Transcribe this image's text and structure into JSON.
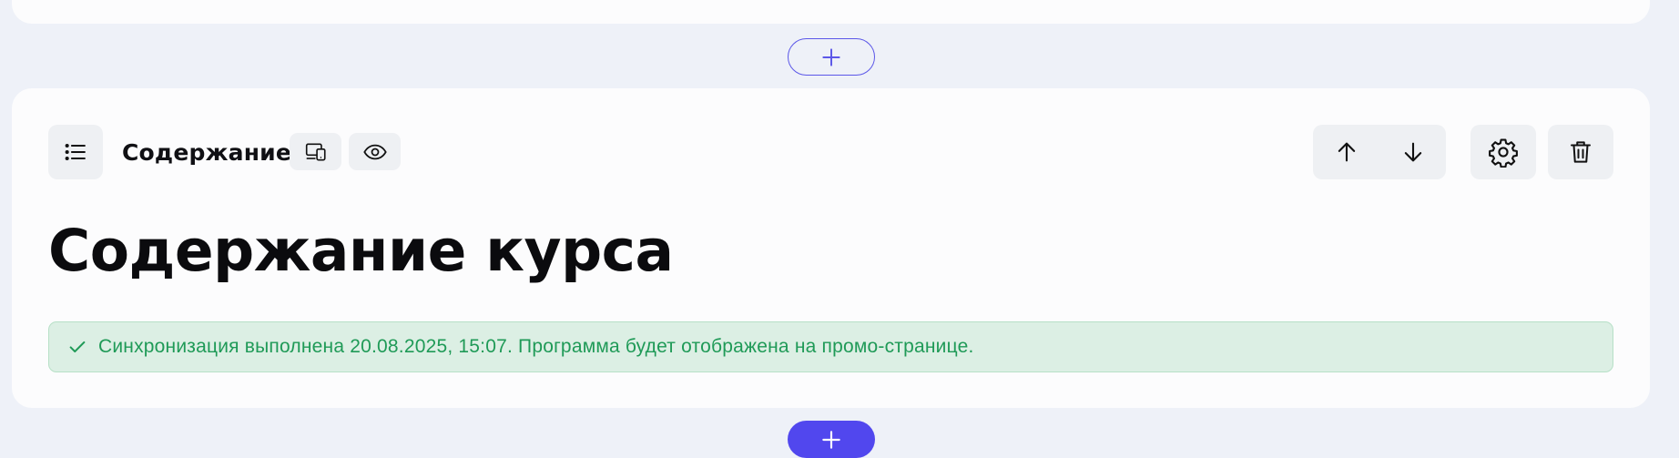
{
  "block": {
    "label": "Содержание",
    "heading": "Содержание курса"
  },
  "sync_banner": {
    "text": "Синхронизация выполнена 20.08.2025, 15:07. Программа будет отображена на промо-странице."
  },
  "colors": {
    "accent": "#5147ee",
    "success_text": "#1f9a57",
    "success_bg": "#dcefe4",
    "page_bg": "#eef1f8"
  },
  "icons": [
    "plus-icon",
    "list-icon",
    "devices-icon",
    "eye-icon",
    "arrow-up-icon",
    "arrow-down-icon",
    "gear-icon",
    "trash-icon",
    "check-icon"
  ]
}
